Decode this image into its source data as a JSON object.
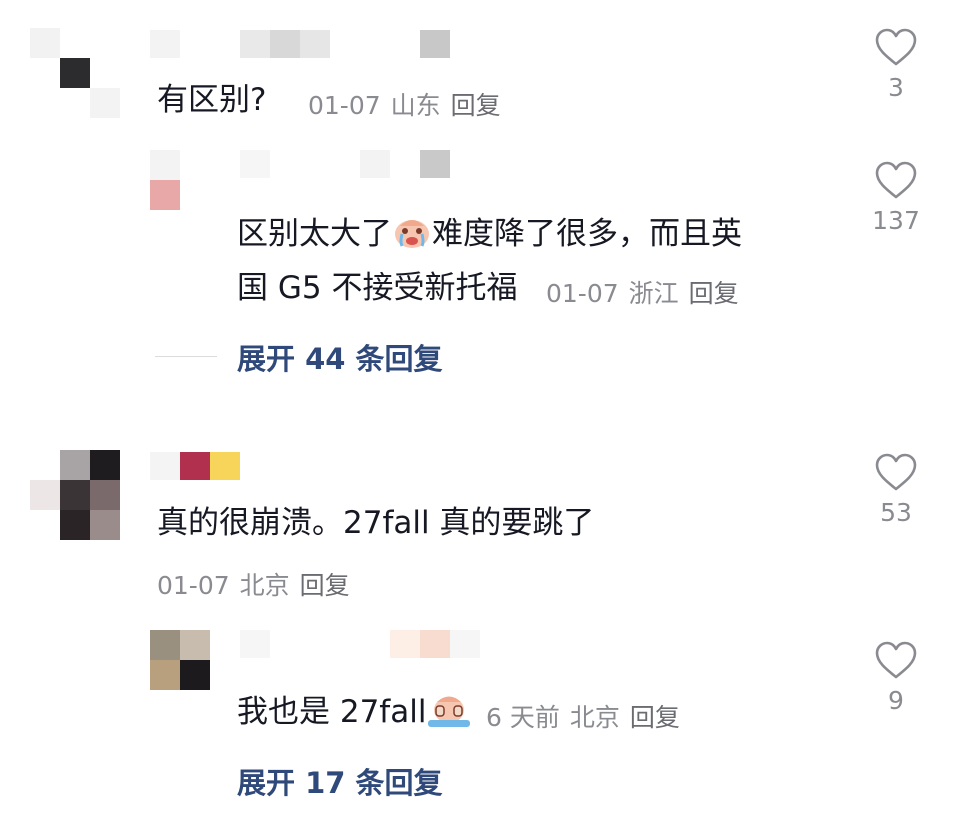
{
  "comments": [
    {
      "text": "有区别?",
      "date": "01-07",
      "location": "山东",
      "reply_label": "回复",
      "likes": "3",
      "replies": [
        {
          "text_line1_a": "区别太大了",
          "emoji1": "crying-face-emoji",
          "text_line1_b": "难度降了很多，而且英",
          "text_line2": "国 G5 不接受新托福",
          "date": "01-07",
          "location": "浙江",
          "reply_label": "回复",
          "likes": "137"
        }
      ],
      "expand_label": "展开 44 条回复"
    },
    {
      "text": "真的很崩溃。27fall 真的要跳了",
      "date": "01-07",
      "location": "北京",
      "reply_label": "回复",
      "likes": "53",
      "replies": [
        {
          "text": "我也是 27fall",
          "emoji1": "sobbing-face-emoji",
          "date": "6 天前",
          "location": "北京",
          "reply_label": "回复",
          "likes": "9"
        }
      ],
      "expand_label": "展开 17 条回复"
    }
  ],
  "colors": {
    "text": "#161823",
    "meta": "#8a8b91",
    "expand": "#2f4a7a",
    "heart_stroke": "#8a8b91"
  },
  "icons": {
    "like": "heart-outline-icon",
    "expand_line": "divider-line"
  }
}
